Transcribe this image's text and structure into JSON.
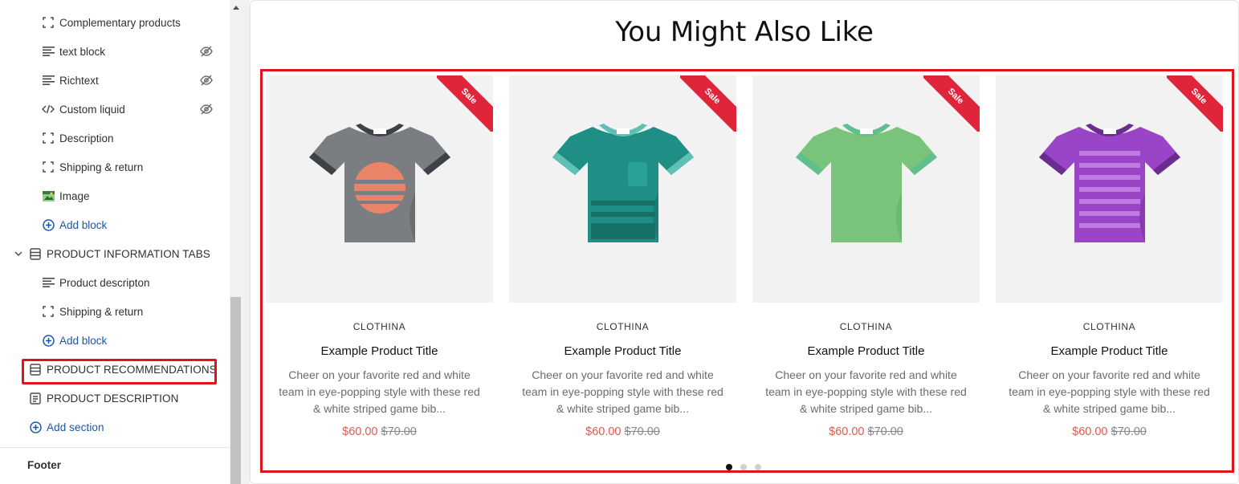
{
  "sidebar": {
    "blocks": [
      {
        "label": "Complementary products",
        "icon": "bracket-frame-icon",
        "hidden": false
      },
      {
        "label": "text block",
        "icon": "text-lines-icon",
        "hidden": true
      },
      {
        "label": "Richtext",
        "icon": "text-lines-icon",
        "hidden": true
      },
      {
        "label": "Custom liquid",
        "icon": "code-icon",
        "hidden": true
      },
      {
        "label": "Description",
        "icon": "bracket-frame-icon",
        "hidden": false
      },
      {
        "label": "Shipping & return",
        "icon": "bracket-frame-icon",
        "hidden": false
      },
      {
        "label": "Image",
        "icon": "image-icon",
        "hidden": false
      }
    ],
    "add_block_label": "Add block",
    "tabs_section": {
      "label": "PRODUCT INFORMATION TABS",
      "blocks": [
        {
          "label": "Product descripton",
          "icon": "text-lines-icon"
        },
        {
          "label": "Shipping & return",
          "icon": "bracket-frame-icon"
        }
      ],
      "add_block_label": "Add block"
    },
    "recommendations_label": "PRODUCT RECOMMENDATIONS",
    "description_label": "PRODUCT DESCRIPTION",
    "add_section_label": "Add section",
    "footer_label": "Footer"
  },
  "preview": {
    "heading": "You Might Also Like",
    "products": [
      {
        "vendor": "CLOTHINA",
        "title": "Example Product Title",
        "description": "Cheer on your favorite red and white team in eye-popping style with these red & white striped game bib...",
        "price": "$60.00",
        "compare_price": "$70.00",
        "badge": "Sale",
        "shirt_color": "#7a7d82",
        "shirt_shade": "#5f6266",
        "collar": "#3e4145"
      },
      {
        "vendor": "CLOTHINA",
        "title": "Example Product Title",
        "description": "Cheer on your favorite red and white team in eye-popping style with these red & white striped game bib...",
        "price": "$60.00",
        "compare_price": "$70.00",
        "badge": "Sale",
        "shirt_color": "#1f8f86",
        "shirt_shade": "#177068",
        "collar": "#5fc0b4"
      },
      {
        "vendor": "CLOTHINA",
        "title": "Example Product Title",
        "description": "Cheer on your favorite red and white team in eye-popping style with these red & white striped game bib...",
        "price": "$60.00",
        "compare_price": "$70.00",
        "badge": "Sale",
        "shirt_color": "#79c47a",
        "shirt_shade": "#66b06a",
        "collar": "#5fbf8f"
      },
      {
        "vendor": "CLOTHINA",
        "title": "Example Product Title",
        "description": "Cheer on your favorite red and white team in eye-popping style with these red & white striped game bib...",
        "price": "$60.00",
        "compare_price": "$70.00",
        "badge": "Sale",
        "shirt_color": "#9a45c8",
        "shirt_shade": "#7a35a4",
        "collar": "#6a2c8e"
      }
    ],
    "slider_dots": 3,
    "active_dot": 0
  },
  "colors": {
    "highlight": "#e0141c",
    "link": "#1a56a8",
    "sale_price": "#e05a4f",
    "ribbon": "#e0243a"
  }
}
